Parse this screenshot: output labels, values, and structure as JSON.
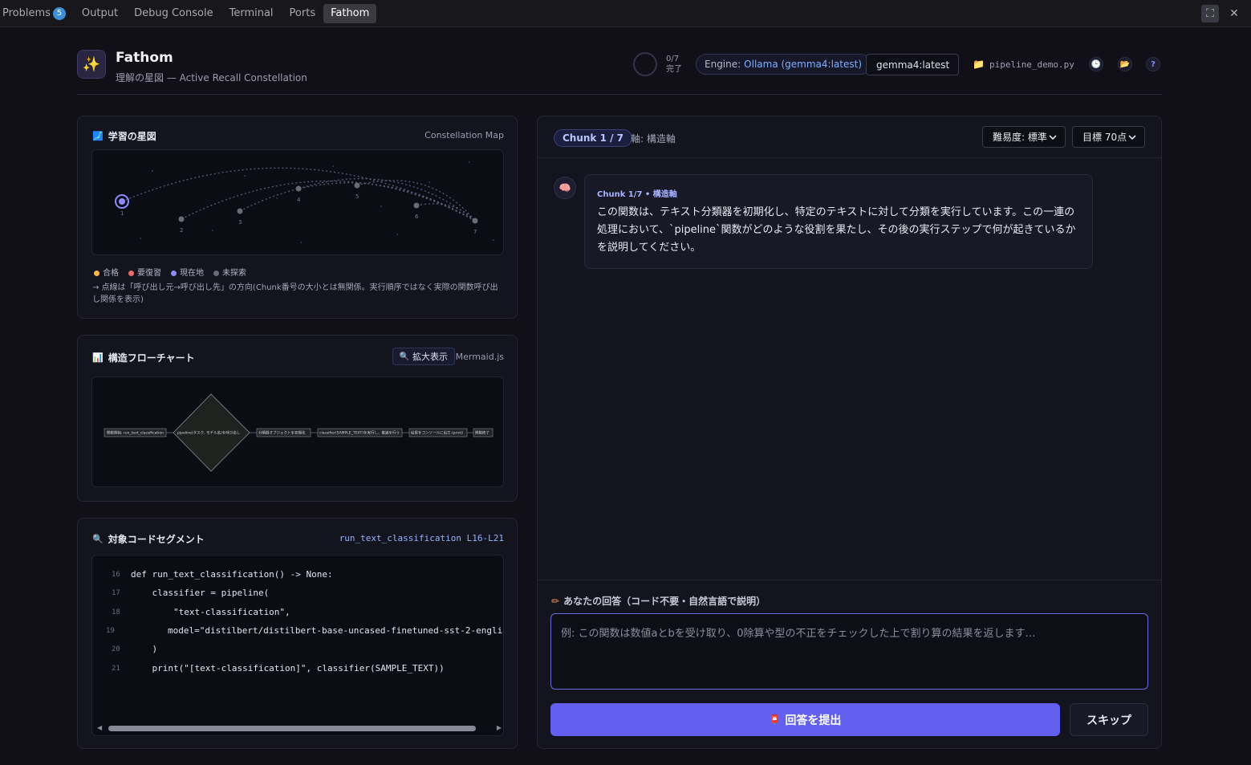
{
  "panel_tabs": {
    "problems_label": "Problems",
    "problems_count": "5",
    "output_label": "Output",
    "debug_console_label": "Debug Console",
    "terminal_label": "Terminal",
    "ports_label": "Ports",
    "fathom_label": "Fathom"
  },
  "window_icons": {
    "maximize": "maximize-icon",
    "close": "close-icon"
  },
  "header": {
    "title": "Fathom",
    "subtitle": "理解の星図 — Active Recall Constellation",
    "progress_count": "0/7",
    "progress_label": "完了",
    "engine_label": "Engine:",
    "engine_value": "Ollama (gemma4:latest)",
    "model_select": "gemma4:latest",
    "file_name": "pipeline_demo.py"
  },
  "constellation": {
    "title": "学習の星図",
    "meta": "Constellation Map",
    "star_labels": [
      "1",
      "2",
      "3",
      "4",
      "5",
      "6",
      "7"
    ],
    "legend": [
      {
        "label": "合格",
        "color": "#f5b942"
      },
      {
        "label": "要復習",
        "color": "#f06a6a"
      },
      {
        "label": "現在地",
        "color": "#8c8cff"
      },
      {
        "label": "未探索",
        "color": "#6a6a78"
      }
    ],
    "note": "→ 点線は「呼び出し元→呼び出し先」の方向(Chunk番号の大小とは無関係。実行順序ではなく実際の関数呼び出し関係を表示)"
  },
  "flowchart": {
    "title": "構造フローチャート",
    "zoom_button": "拡大表示",
    "meta": "Mermaid.js",
    "nodes": [
      "関数開始: run_text_classification",
      "pipeline(タスク, モデル名)を呼び出し",
      "分類器オブジェクトを初期化",
      "classifier(SAMPLE_TEXT)を実行し、推論を行う",
      "結果をコンソールに出力 (print)",
      "関数終了"
    ]
  },
  "code_segment": {
    "title": "対象コードセグメント",
    "location": "run_text_classification L16-L21",
    "lines": [
      {
        "num": "16",
        "text": "def run_text_classification() -> None:"
      },
      {
        "num": "17",
        "text": "    classifier = pipeline("
      },
      {
        "num": "18",
        "text": "        \"text-classification\","
      },
      {
        "num": "19",
        "text": "        model=\"distilbert/distilbert-base-uncased-finetuned-sst-2-englis"
      },
      {
        "num": "20",
        "text": "    )"
      },
      {
        "num": "21",
        "text": "    print(\"[text-classification]\", classifier(SAMPLE_TEXT))"
      }
    ]
  },
  "question_panel": {
    "chunk_pill": "Chunk 1 / 7",
    "axis_label": "軸: 構造軸",
    "difficulty_select": "難易度: 標準",
    "target_select": "目標 70点",
    "bubble_meta": "Chunk 1/7 • 構造軸",
    "question": "この関数は、テキスト分類器を初期化し、特定のテキストに対して分類を実行しています。この一連の処理において、`pipeline`関数がどのような役割を果たし、その後の実行ステップで何が起きているかを説明してください。",
    "answer_label": "あなたの回答（コード不要・自然言語で説明）",
    "answer_placeholder": "例: この関数は数値aとbを受け取り、0除算や型の不正をチェックした上で割り算の結果を返します…",
    "submit_label": "回答を提出",
    "skip_label": "スキップ"
  },
  "colors": {
    "accent": "#6360f0",
    "background": "#111019",
    "card": "#14141f",
    "current_star": "#8c8cff"
  }
}
